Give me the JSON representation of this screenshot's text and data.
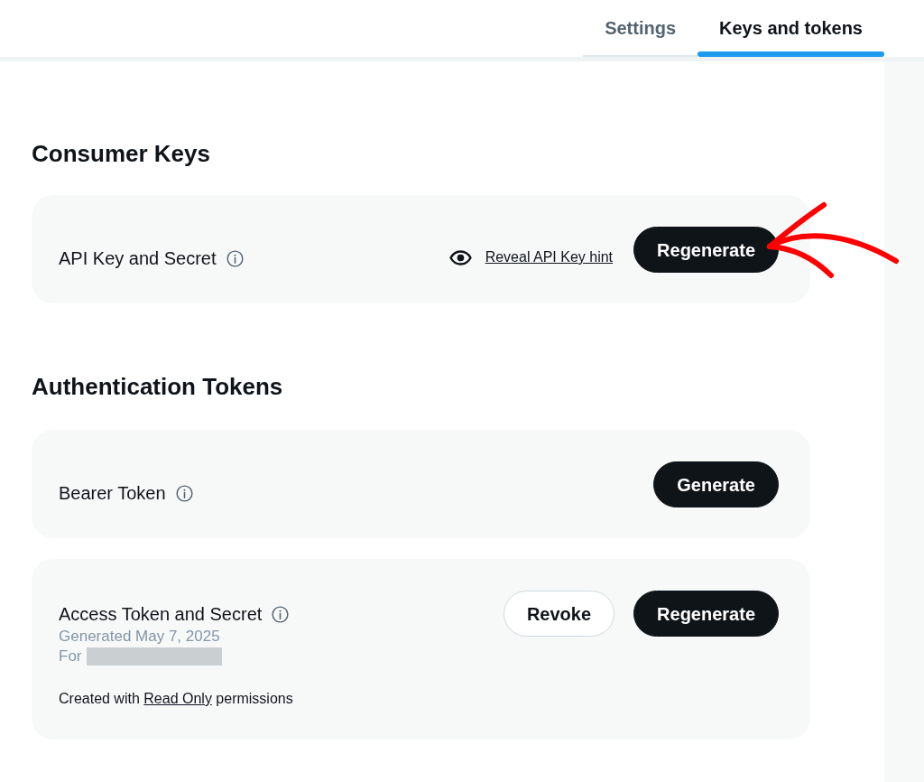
{
  "tabs": [
    {
      "label": "Settings",
      "selected": false
    },
    {
      "label": "Keys and tokens",
      "selected": true
    }
  ],
  "sections": [
    {
      "title": "Consumer Keys",
      "cards": [
        {
          "label": "API Key and Secret",
          "reveal_link": "Reveal API Key hint",
          "buttons": [
            {
              "label": "Regenerate",
              "kind": "primary"
            }
          ]
        }
      ]
    },
    {
      "title": "Authentication Tokens",
      "cards": [
        {
          "label": "Bearer Token",
          "buttons": [
            {
              "label": "Generate",
              "kind": "primary"
            }
          ]
        },
        {
          "label": "Access Token and Secret",
          "generated": "Generated May 7, 2025",
          "for_label": "For",
          "note": {
            "prefix": "Created with",
            "link": "Read Only",
            "suffix": "permissions"
          },
          "buttons": [
            {
              "label": "Revoke",
              "kind": "secondary"
            },
            {
              "label": "Regenerate",
              "kind": "primary"
            }
          ]
        }
      ]
    }
  ]
}
